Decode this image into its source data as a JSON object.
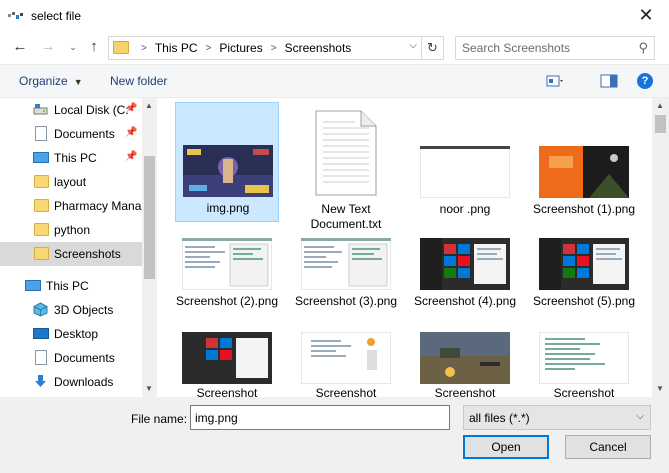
{
  "window": {
    "title": "select file"
  },
  "address": {
    "crumbs": [
      "This PC",
      "Pictures",
      "Screenshots"
    ]
  },
  "search": {
    "placeholder": "Search Screenshots"
  },
  "toolbar": {
    "organize": "Organize",
    "new_folder": "New folder"
  },
  "nav": {
    "items": [
      {
        "label": "Local Disk (C:",
        "icon": "drive-icon",
        "pinned": true
      },
      {
        "label": "Documents",
        "icon": "documents-icon",
        "pinned": true
      },
      {
        "label": "This PC",
        "icon": "pc-icon",
        "pinned": true
      },
      {
        "label": "layout",
        "icon": "folder-icon",
        "pinned": false
      },
      {
        "label": "Pharmacy Mana",
        "icon": "folder-icon",
        "pinned": false
      },
      {
        "label": "python",
        "icon": "folder-icon",
        "pinned": false
      },
      {
        "label": "Screenshots",
        "icon": "folder-icon",
        "pinned": false,
        "selected": true
      },
      {
        "label": "This PC",
        "icon": "pc-icon",
        "pinned": false
      },
      {
        "label": "3D Objects",
        "icon": "cube-icon",
        "pinned": false
      },
      {
        "label": "Desktop",
        "icon": "desktop-icon",
        "pinned": false
      },
      {
        "label": "Documents",
        "icon": "documents-icon",
        "pinned": false
      },
      {
        "label": "Downloads",
        "icon": "download-icon",
        "pinned": false
      }
    ]
  },
  "files": [
    {
      "name": "img.png",
      "kind": "game",
      "selected": true
    },
    {
      "name": "New Text Document.txt",
      "kind": "text"
    },
    {
      "name": "noor .png",
      "kind": "blank"
    },
    {
      "name": "Screenshot (1).png",
      "kind": "orange"
    },
    {
      "name": "Screenshot (2).png",
      "kind": "code"
    },
    {
      "name": "Screenshot (3).png",
      "kind": "code"
    },
    {
      "name": "Screenshot (4).png",
      "kind": "win"
    },
    {
      "name": "Screenshot (5).png",
      "kind": "win"
    },
    {
      "name": "Screenshot",
      "kind": "win"
    },
    {
      "name": "Screenshot",
      "kind": "code2"
    },
    {
      "name": "Screenshot",
      "kind": "game2"
    },
    {
      "name": "Screenshot",
      "kind": "code3"
    }
  ],
  "footer": {
    "file_name_label": "File name:",
    "file_name_value": "img.png",
    "filter": "all files (*.*)",
    "open": "Open",
    "cancel": "Cancel"
  }
}
